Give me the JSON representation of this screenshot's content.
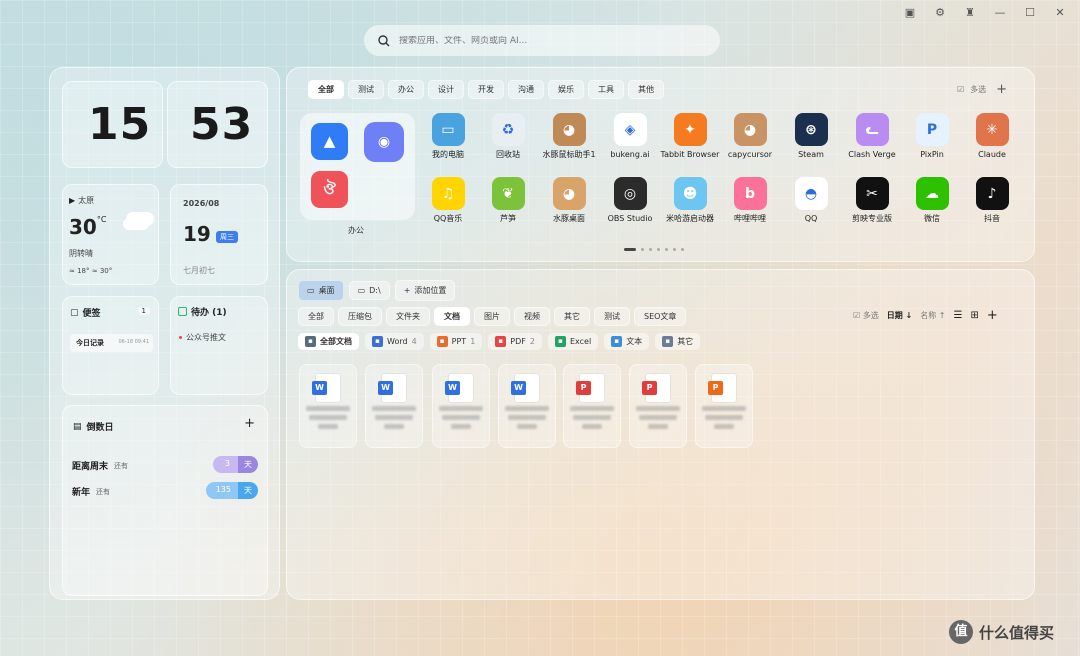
{
  "window": {
    "controls": [
      "skin-icon",
      "settings-icon",
      "shirt-icon",
      "minimize-icon",
      "maximize-icon",
      "close-icon"
    ]
  },
  "search": {
    "placeholder": "搜索应用、文件、网页或向 AI..."
  },
  "clock": {
    "hour": "15",
    "minute": "53"
  },
  "weather": {
    "city": "太原",
    "temp": "30",
    "unit": "°C",
    "desc": "阴转晴",
    "range": "≈ 18° ≈ 30°"
  },
  "calendar": {
    "month_label": "2026/08",
    "day": "19",
    "weekday": "周三",
    "lunar": "七月初七"
  },
  "notes": {
    "title": "便签",
    "count": "1",
    "item_title": "今日记录",
    "item_time": "06-18 09:41"
  },
  "todo": {
    "title": "待办 (1)",
    "items": [
      "公众号推文"
    ]
  },
  "countdown": {
    "title": "倒数日",
    "add": "+",
    "items": [
      {
        "name": "距离周末",
        "status": "还有",
        "days": "3",
        "unit": "天"
      },
      {
        "name": "新年",
        "status": "还有",
        "days": "135",
        "unit": "天"
      }
    ]
  },
  "apps": {
    "tabs": [
      "全部",
      "测试",
      "办公",
      "设计",
      "开发",
      "沟通",
      "娱乐",
      "工具",
      "其他"
    ],
    "multi_select": "多选",
    "add": "+",
    "folder_label": "办公",
    "items": [
      {
        "name": "我的电脑",
        "icon": "computer-icon",
        "color": "#4aa3df"
      },
      {
        "name": "回收站",
        "icon": "recycle-bin-icon",
        "color": "#e8eef2"
      },
      {
        "name": "水豚鼠标助手1",
        "icon": "capybara-icon",
        "color": "#c08a56"
      },
      {
        "name": "bukeng.ai",
        "icon": "bukeng-icon",
        "color": "#ffffff"
      },
      {
        "name": "Tabbit Browser",
        "icon": "tabbit-icon",
        "color": "#f47b20"
      },
      {
        "name": "capycursor",
        "icon": "capybara-icon",
        "color": "#c89466"
      },
      {
        "name": "Steam",
        "icon": "steam-icon",
        "color": "#1b2f4e"
      },
      {
        "name": "Clash Verge",
        "icon": "cat-icon",
        "color": "#b88cf0"
      },
      {
        "name": "PixPin",
        "icon": "pixpin-icon",
        "color": "#e6f2ff"
      },
      {
        "name": "Claude",
        "icon": "claude-icon",
        "color": "#e0744a"
      },
      {
        "name": "QQ音乐",
        "icon": "qq-music-icon",
        "color": "#ffd400"
      },
      {
        "name": "芦笋",
        "icon": "asparagus-icon",
        "color": "#7cc33b"
      },
      {
        "name": "水豚桌面",
        "icon": "capybara-desktop-icon",
        "color": "#d9a46a"
      },
      {
        "name": "OBS Studio",
        "icon": "obs-icon",
        "color": "#2b2b2b"
      },
      {
        "name": "米哈游启动器",
        "icon": "mihoyo-icon",
        "color": "#6cc6ef"
      },
      {
        "name": "哔哩哔哩",
        "icon": "bilibili-icon",
        "color": "#fb7299"
      },
      {
        "name": "QQ",
        "icon": "qq-icon",
        "color": "#ffffff"
      },
      {
        "name": "剪映专业版",
        "icon": "capcut-icon",
        "color": "#111111"
      },
      {
        "name": "微信",
        "icon": "wechat-icon",
        "color": "#2dc100"
      },
      {
        "name": "抖音",
        "icon": "douyin-icon",
        "color": "#111111"
      }
    ],
    "page_count": 7,
    "current_page": 1
  },
  "files": {
    "locations": [
      "桌面",
      "D:\\",
      "添加位置"
    ],
    "type_tabs": [
      "全部",
      "压缩包",
      "文件夹",
      "文档",
      "图片",
      "视频",
      "其它",
      "测试",
      "SEO文章"
    ],
    "active_type": "文档",
    "toolbar": {
      "multi_select": "多选",
      "sort_date": "日期 ↓",
      "sort_name": "名称 ↑"
    },
    "filters": [
      {
        "label": "全部文档",
        "count": "",
        "color": "#5a6a7e",
        "icon": "all-docs-icon"
      },
      {
        "label": "Word",
        "count": "4",
        "color": "#3b6fd4",
        "icon": "word-icon"
      },
      {
        "label": "PPT",
        "count": "1",
        "color": "#e86c2c",
        "icon": "ppt-icon"
      },
      {
        "label": "PDF",
        "count": "2",
        "color": "#e54545",
        "icon": "pdf-icon"
      },
      {
        "label": "Excel",
        "count": "",
        "color": "#21a366",
        "icon": "excel-icon"
      },
      {
        "label": "文本",
        "count": "",
        "color": "#3c8fd6",
        "icon": "text-icon"
      },
      {
        "label": "其它",
        "count": "",
        "color": "#6a7c96",
        "icon": "other-icon"
      }
    ],
    "items": [
      {
        "type": "W",
        "color": "#2f6fe0"
      },
      {
        "type": "W",
        "color": "#2f6fe0"
      },
      {
        "type": "W",
        "color": "#2f6fe0"
      },
      {
        "type": "W",
        "color": "#2f6fe0"
      },
      {
        "type": "P",
        "color": "#e23d3d"
      },
      {
        "type": "P",
        "color": "#e23d3d"
      },
      {
        "type": "P",
        "color": "#ee6a1a"
      }
    ]
  },
  "watermark": {
    "text": "什么值得买"
  }
}
